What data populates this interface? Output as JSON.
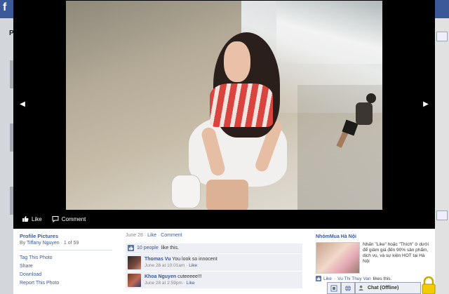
{
  "background": {
    "logo_letter": "f",
    "left_letter": "P"
  },
  "theater": {
    "prev_label": "◀",
    "next_label": "▶",
    "actions": {
      "like_label": "Like",
      "comment_label": "Comment"
    }
  },
  "album": {
    "title": "Profile Pictures",
    "by_prefix": "By",
    "owner": "Tiffany Nguyen",
    "position": "· 1 of 59",
    "menu": [
      "Tag This Photo",
      "Share",
      "Download",
      "Report This Photo"
    ]
  },
  "feedback": {
    "date": "June 28",
    "like_link": "Like",
    "comment_link": "Comment",
    "likes_count_link": "10 people",
    "likes_suffix": "like this.",
    "comments": [
      {
        "author": "Thomas Vu",
        "text": "You look so innocent",
        "time": "June 28 at 10:01am",
        "like_link": "Like"
      },
      {
        "author": "Khoa Nguyen",
        "text": "cuteeeee!!!",
        "time": "June 28 at 2:59pm",
        "like_link": "Like"
      }
    ]
  },
  "ad": {
    "title": "NhómMua Hà Nội",
    "text": "Nhấn \"Like\" hoặc \"Thích\" ở dưới để giảm giá đến 90% sản phẩm, dịch vụ, và sự kiện HOT tại Hà Nội",
    "like_link": "Like",
    "liker": "Vu Thi Thuy Van",
    "like_suffix": "likes this."
  },
  "chat": {
    "label": "Chat (Offline)"
  }
}
